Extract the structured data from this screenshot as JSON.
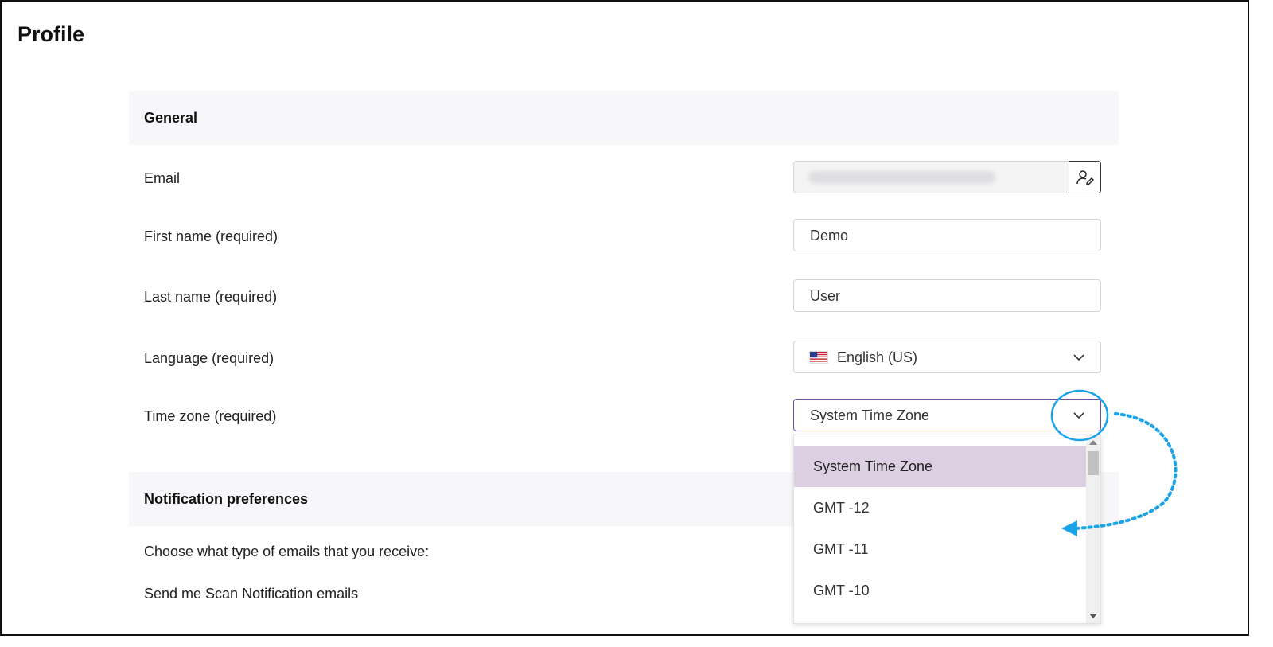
{
  "page": {
    "title": "Profile"
  },
  "general": {
    "header": "General",
    "email": {
      "label": "Email",
      "edit_icon": "user-edit-icon"
    },
    "first_name": {
      "label": "First name (required)",
      "value": "Demo"
    },
    "last_name": {
      "label": "Last name (required)",
      "value": "User"
    },
    "language": {
      "label": "Language (required)",
      "value": "English (US)",
      "flag_icon": "us-flag-icon"
    },
    "timezone": {
      "label": "Time zone (required)",
      "value": "System Time Zone",
      "options": [
        "System Time Zone",
        "GMT -12",
        "GMT -11",
        "GMT -10"
      ]
    }
  },
  "notifications": {
    "header": "Notification preferences",
    "description": "Choose what type of emails that you receive:",
    "scan_label": "Send me Scan Notification emails"
  },
  "colors": {
    "focus_border": "#6b4fa0",
    "selected_option": "#dccfe1",
    "annotation": "#1aa3e8"
  }
}
